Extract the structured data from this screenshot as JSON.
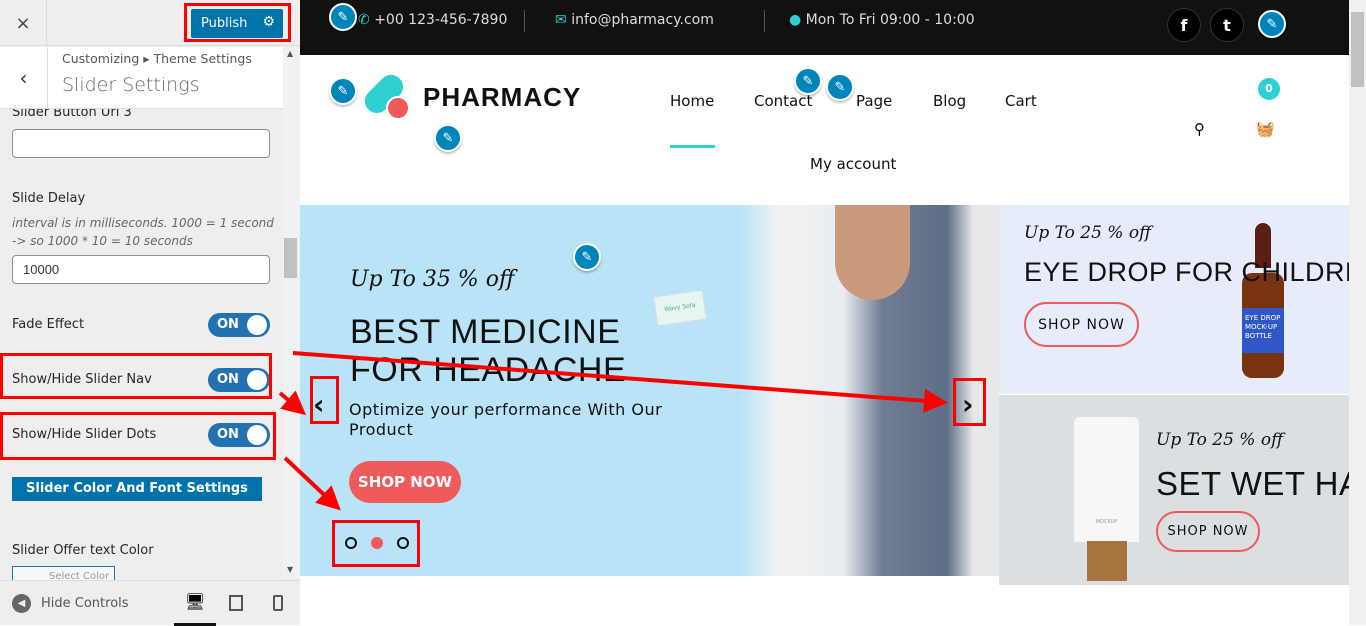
{
  "customizer": {
    "close_label": "×",
    "publish_label": "Publish",
    "breadcrumb": "Customizing ▸ Theme Settings",
    "section_title": "Slider Settings",
    "fields": {
      "button_url_3": {
        "label": "Slider Button Url 3",
        "value": ""
      },
      "slide_delay": {
        "label": "Slide Delay",
        "description": "interval is in milliseconds. 1000 = 1 second -> so 1000 * 10 = 10 seconds",
        "value": "10000"
      },
      "fade_effect": {
        "label": "Fade Effect",
        "state": "ON"
      },
      "slider_nav": {
        "label": "Show/Hide Slider Nav",
        "state": "ON"
      },
      "slider_dots": {
        "label": "Show/Hide Slider Dots",
        "state": "ON"
      },
      "color_font_button": "Slider Color And Font Settings",
      "offer_text_color": {
        "label": "Slider Offer text Color",
        "button": "Select Color"
      }
    },
    "footer": {
      "hide_controls": "Hide Controls"
    }
  },
  "site": {
    "topbar": {
      "phone": "+00 123-456-7890",
      "email": "info@pharmacy.com",
      "hours": "Mon To Fri 09:00 - 10:00",
      "social": [
        "f",
        "t"
      ]
    },
    "logo": "PHARMACY",
    "nav": [
      "Home",
      "Contact",
      "Page",
      "Blog",
      "Cart",
      "My account"
    ],
    "active_nav": "Home",
    "cart_count": "0",
    "slider": {
      "offer": "Up To 35 % off",
      "title": "BEST MEDICINE FOR HEADACHE",
      "subtitle": "Optimize your performance With Our Product",
      "button": "SHOP NOW",
      "dots": 3,
      "active_dot": 2,
      "card_text": "Wavy Sofa"
    },
    "banners": [
      {
        "offer": "Up To 25 % off",
        "title": "EYE DROP FOR CHILDRENS",
        "button": "SHOP NOW",
        "product_label": "EYE DROP MOCK-UP BOTTLE"
      },
      {
        "offer": "Up To 25 % off",
        "title": "SET WET HAIR",
        "button": "SHOP NOW",
        "product_label": "MOCKUP"
      }
    ]
  },
  "colors": {
    "accent": "#2fd0d2",
    "sale": "#ef5a5a",
    "wp_blue": "#0073aa",
    "annotation": "#ff0000"
  }
}
